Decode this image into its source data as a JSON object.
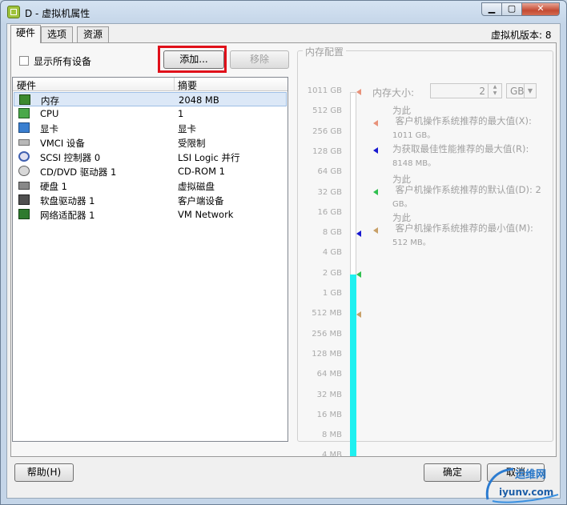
{
  "window": {
    "title": "D - 虚拟机属性",
    "min": "▁",
    "max": "▢",
    "close": "✕"
  },
  "tabs": [
    {
      "label": "硬件"
    },
    {
      "label": "选项"
    },
    {
      "label": "资源"
    }
  ],
  "vm_version": "虚拟机版本: 8",
  "show_all_devices": {
    "label": "显示所有设备",
    "checked": false
  },
  "buttons": {
    "add": "添加...",
    "remove": "移除",
    "help": "帮助(H)",
    "ok": "确定",
    "cancel": "取消"
  },
  "hardware_table": {
    "headers": [
      "硬件",
      "摘要"
    ],
    "rows": [
      {
        "name": "内存",
        "summary": "2048 MB",
        "icon": "memory-icon",
        "selected": true
      },
      {
        "name": "CPU",
        "summary": "1",
        "icon": "cpu-icon"
      },
      {
        "name": "显卡",
        "summary": "显卡",
        "icon": "display-icon"
      },
      {
        "name": "VMCI 设备",
        "summary": "受限制",
        "icon": "vmci-icon"
      },
      {
        "name": "SCSI 控制器  0",
        "summary": "LSI Logic 并行",
        "icon": "scsi-icon"
      },
      {
        "name": "CD/DVD 驱动器  1",
        "summary": "CD-ROM 1",
        "icon": "cdrom-icon"
      },
      {
        "name": "硬盘  1",
        "summary": "虚拟磁盘",
        "icon": "harddisk-icon"
      },
      {
        "name": "软盘驱动器  1",
        "summary": "客户端设备",
        "icon": "floppy-icon"
      },
      {
        "name": "网络适配器  1",
        "summary": "VM Network",
        "icon": "network-icon"
      }
    ]
  },
  "memory": {
    "legend": "内存配置",
    "size_label": "内存大小:",
    "size_value": "2",
    "unit": "GB",
    "scale_ticks": [
      "1011 GB",
      "512 GB",
      "256 GB",
      "128 GB",
      "64 GB",
      "32 GB",
      "16 GB",
      "8 GB",
      "4 GB",
      "2 GB",
      "1 GB",
      "512 MB",
      "256 MB",
      "128 MB",
      "64 MB",
      "32 MB",
      "16 MB",
      "8 MB",
      "4 MB"
    ],
    "current_tick_index": 9,
    "markers": [
      {
        "tick_index": 0,
        "color": "#e8927a"
      },
      {
        "tick_index": 7,
        "color": "#1818d0"
      },
      {
        "tick_index": 9,
        "color": "#30c050"
      },
      {
        "tick_index": 11,
        "color": "#c8a068"
      }
    ],
    "recommendations": [
      {
        "line1": "为此",
        "line2": "客户机操作系统推荐的最大值(X):",
        "value": "1011 GB。",
        "color": "#e8927a"
      },
      {
        "line1": "为获取最佳性能推荐的最大值(R):",
        "line2": "",
        "value": "8148 MB。",
        "color": "#1818d0"
      },
      {
        "line1": "为此",
        "line2": "客户机操作系统推荐的默认值(D): 2",
        "value": "GB。",
        "color": "#30c050"
      },
      {
        "line1": "为此",
        "line2": "客户机操作系统推荐的最小值(M):",
        "value": "512 MB。",
        "color": "#c8a068"
      }
    ]
  },
  "watermark": {
    "line1": "运维网",
    "line2": "iyunv.com"
  }
}
